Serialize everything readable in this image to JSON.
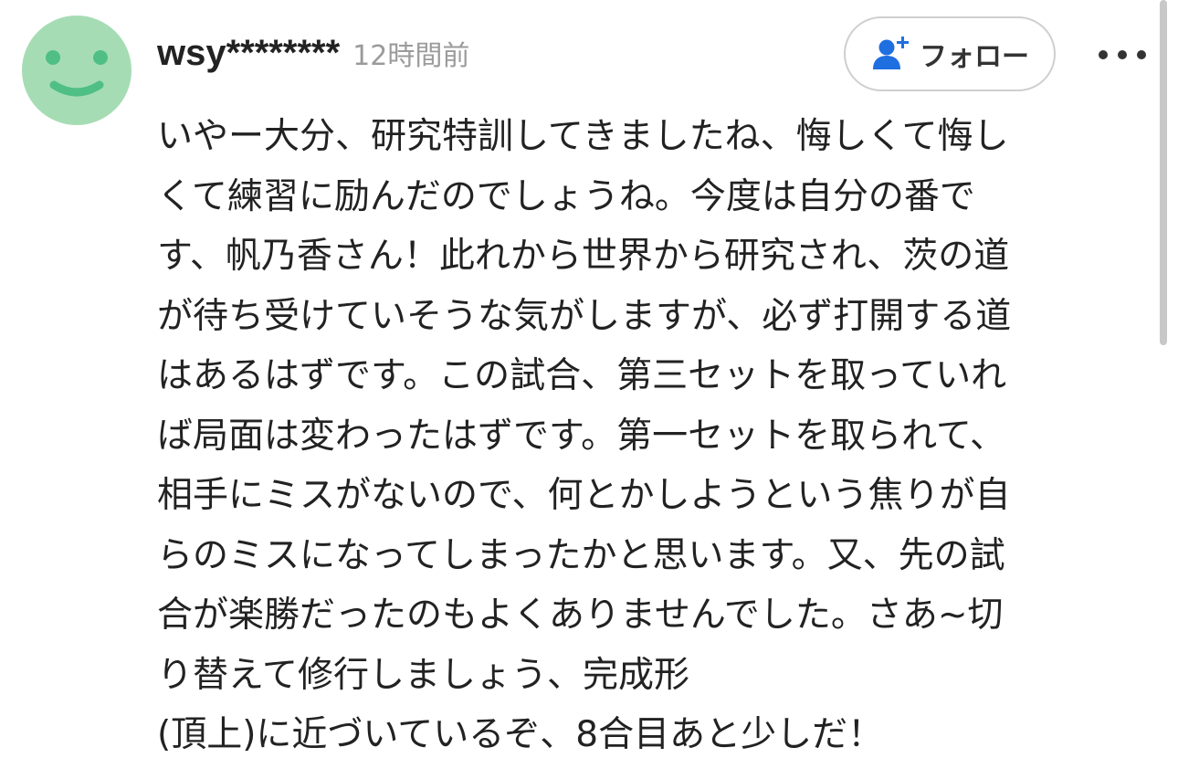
{
  "comment": {
    "username": "wsy********",
    "timestamp": "12時間前",
    "follow_label": "フォロー",
    "avatar_icon": "smiley-face-icon",
    "follow_icon": "person-add-icon",
    "more_icon": "more-dots-icon",
    "colors": {
      "avatar_bg": "#a6dcb4",
      "avatar_face": "#4fbf86",
      "follow_icon": "#1f6fe0",
      "text": "#222222",
      "muted": "#9b9b9b"
    },
    "lines": [
      "いやー大分、研究特訓してきましたね、悔しくて悔し",
      "くて練習に励んだのでしょうね。今度は自分の番で",
      "す、帆乃香さん！此れから世界から研究され、茨の道",
      "が待ち受けていそうな気がしますが、必ず打開する道",
      "はあるはずです。この試合、第三セットを取っていれ",
      "ば局面は変わったはずです。第一セットを取られて、",
      "相手にミスがないので、何とかしようという焦りが自",
      "らのミスになってしまったかと思います。又、先の試",
      "合が楽勝だったのもよくありませんでした。さあ~切",
      "り替えて修行しましょう、完成形",
      "(頂上)に近づいているぞ、8合目あと少しだ！"
    ]
  }
}
